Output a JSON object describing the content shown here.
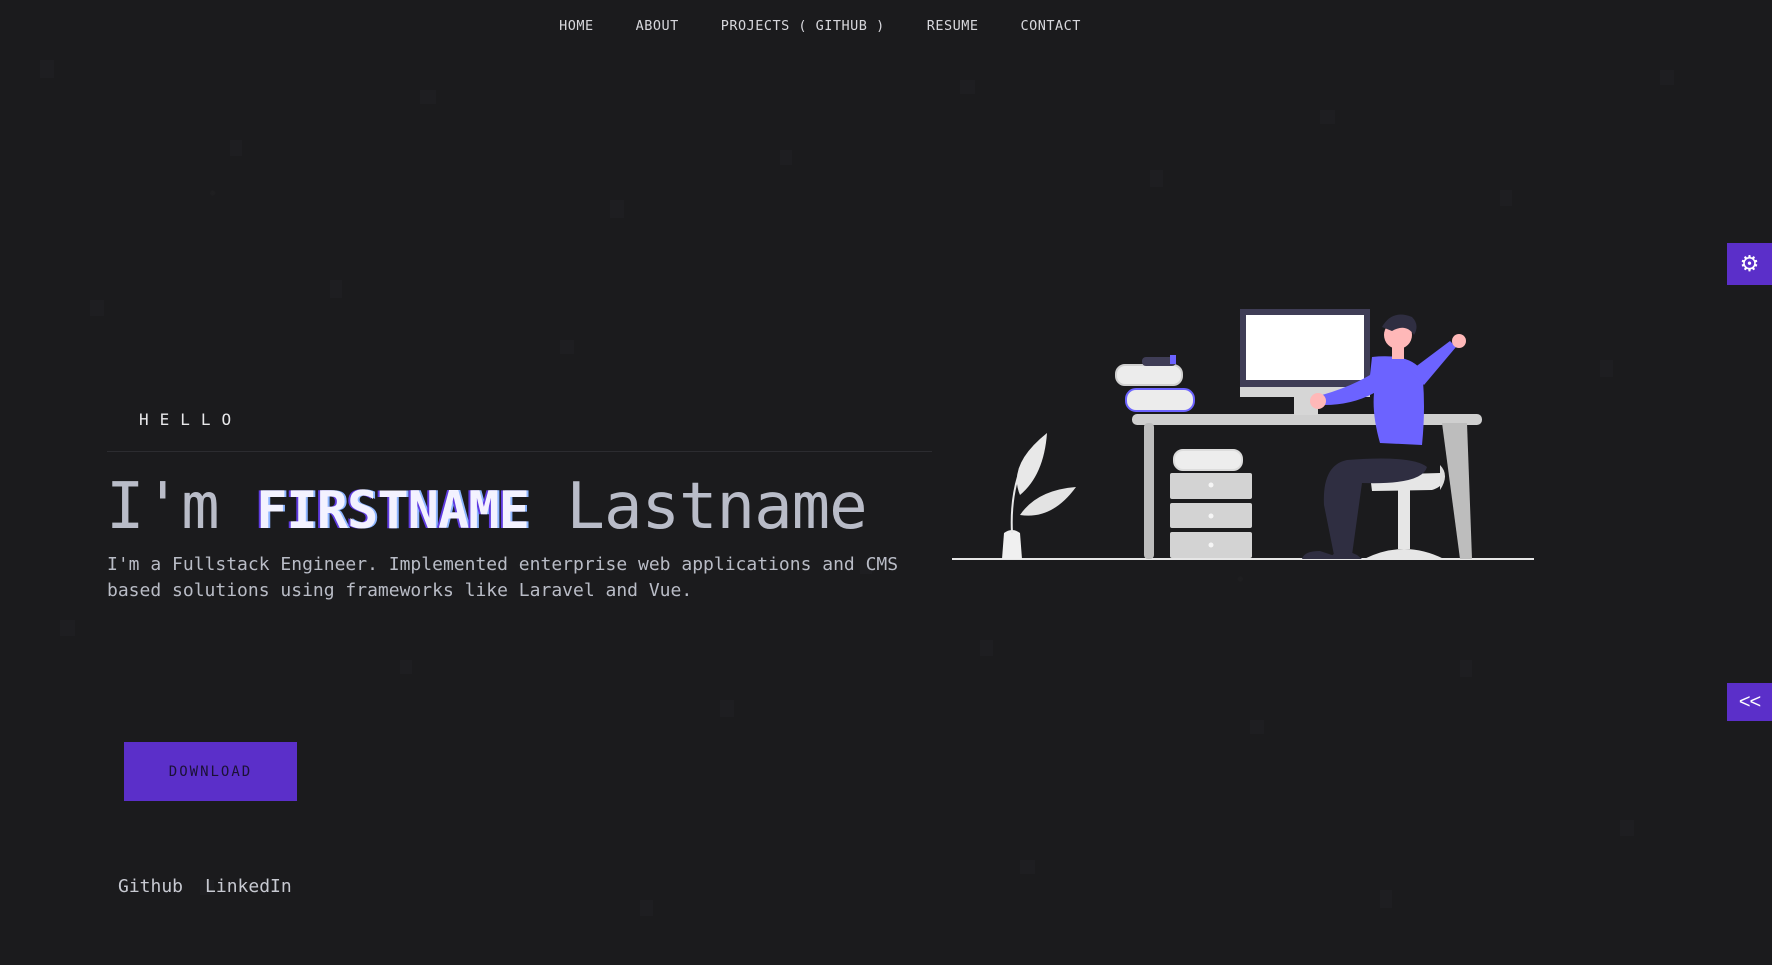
{
  "nav": {
    "items": [
      "HOME",
      "ABOUT",
      "PROJECTS ( GITHUB )",
      "RESUME",
      "CONTACT"
    ]
  },
  "hero": {
    "greeting": "HELLO",
    "prefix": "I'm",
    "firstname": "FIRSTNAME",
    "lastname": "Lastname",
    "intro": "I'm a Fullstack Engineer. Implemented enterprise web applications and CMS based solutions using frameworks like Laravel and Vue.",
    "download_label": "DOWNLOAD"
  },
  "social": {
    "github": "Github",
    "linkedin": "LinkedIn"
  },
  "side": {
    "settings_icon": "gear-icon",
    "collapse_label": "<<"
  },
  "colors": {
    "background": "#1b1b1d",
    "accent": "#5b2fc9",
    "figure_shirt": "#6c63ff"
  }
}
